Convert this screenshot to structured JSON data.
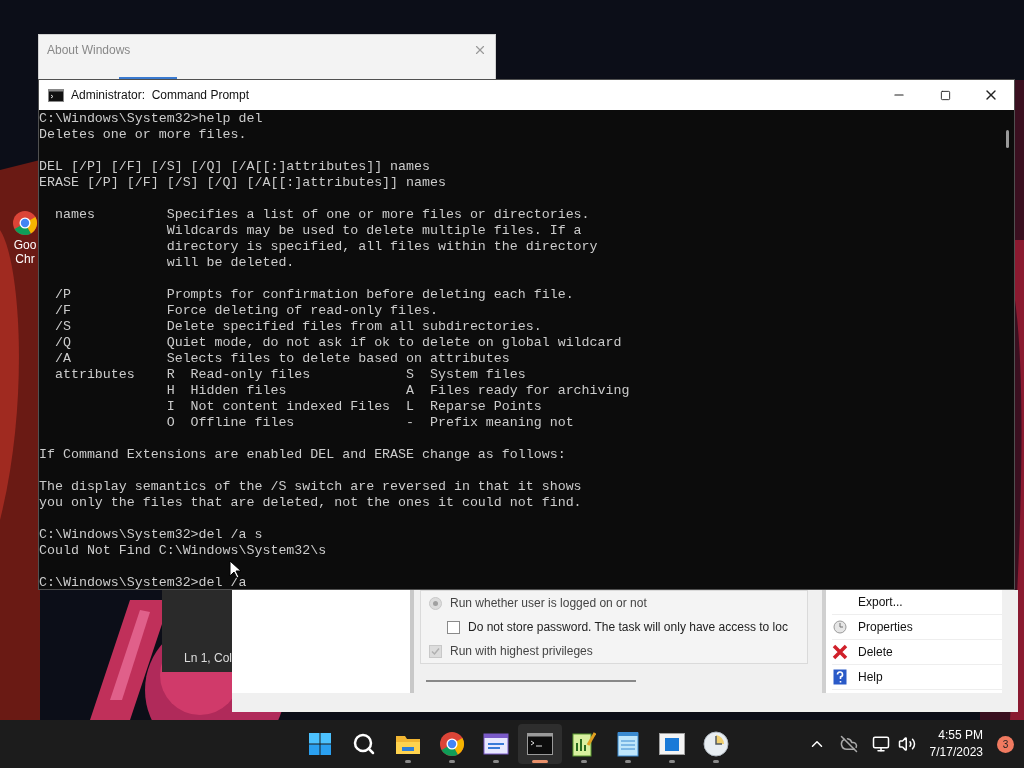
{
  "desktop_icon": {
    "label_lines": [
      "Goo",
      "Chr"
    ]
  },
  "about_window": {
    "title": "About Windows"
  },
  "notepad": {
    "status": "Ln 1, Col"
  },
  "scheduler": {
    "options": [
      {
        "kind": "radio",
        "label": "Run whether user is logged on or not",
        "checked": true,
        "disabled": true
      },
      {
        "kind": "checkbox",
        "label": "Do not store password.  The task will only have access to loc",
        "checked": false,
        "disabled": false
      },
      {
        "kind": "checkbox",
        "label": "Run with highest privileges",
        "checked": true,
        "disabled": true
      }
    ],
    "actions": [
      {
        "kind": "none",
        "label": "Export..."
      },
      {
        "kind": "properties",
        "label": "Properties"
      },
      {
        "kind": "delete",
        "label": "Delete"
      },
      {
        "kind": "help",
        "label": "Help"
      }
    ]
  },
  "console": {
    "title": "Administrator:  Command Prompt",
    "blocks": [
      [
        "C:\\Windows\\System32>help del",
        "Deletes one or more files."
      ],
      [
        "DEL [/P] [/F] [/S] [/Q] [/A[[:]attributes]] names",
        "ERASE [/P] [/F] [/S] [/Q] [/A[[:]attributes]] names"
      ],
      [
        "  names         Specifies a list of one or more files or directories.",
        "                Wildcards may be used to delete multiple files. If a",
        "                directory is specified, all files within the directory",
        "                will be deleted."
      ],
      [
        "  /P            Prompts for confirmation before deleting each file.",
        "  /F            Force deleting of read-only files.",
        "  /S            Delete specified files from all subdirectories.",
        "  /Q            Quiet mode, do not ask if ok to delete on global wildcard",
        "  /A            Selects files to delete based on attributes",
        "  attributes    R  Read-only files            S  System files",
        "                H  Hidden files               A  Files ready for archiving",
        "                I  Not content indexed Files  L  Reparse Points",
        "                O  Offline files              -  Prefix meaning not"
      ],
      [
        "If Command Extensions are enabled DEL and ERASE change as follows:"
      ],
      [
        "The display semantics of the /S switch are reversed in that it shows",
        "you only the files that are deleted, not the ones it could not find."
      ],
      [
        "C:\\Windows\\System32>del /a s",
        "Could Not Find C:\\Windows\\System32\\s"
      ],
      [
        "C:\\Windows\\System32>del /a"
      ]
    ]
  },
  "taskbar": {
    "apps": [
      {
        "kind": "start",
        "selected": false,
        "running": false
      },
      {
        "kind": "search",
        "selected": false,
        "running": false
      },
      {
        "kind": "folder",
        "selected": false,
        "running": true
      },
      {
        "kind": "browser",
        "selected": false,
        "running": true
      },
      {
        "kind": "window",
        "selected": false,
        "running": true
      },
      {
        "kind": "terminal",
        "selected": true,
        "running": true
      },
      {
        "kind": "chart",
        "selected": false,
        "running": true
      },
      {
        "kind": "notepad",
        "selected": false,
        "running": true
      },
      {
        "kind": "bluewindow",
        "selected": false,
        "running": true
      },
      {
        "kind": "clock",
        "selected": false,
        "running": true
      }
    ],
    "time": "4:55 PM",
    "date": "7/17/2023",
    "notification_count": "3"
  }
}
